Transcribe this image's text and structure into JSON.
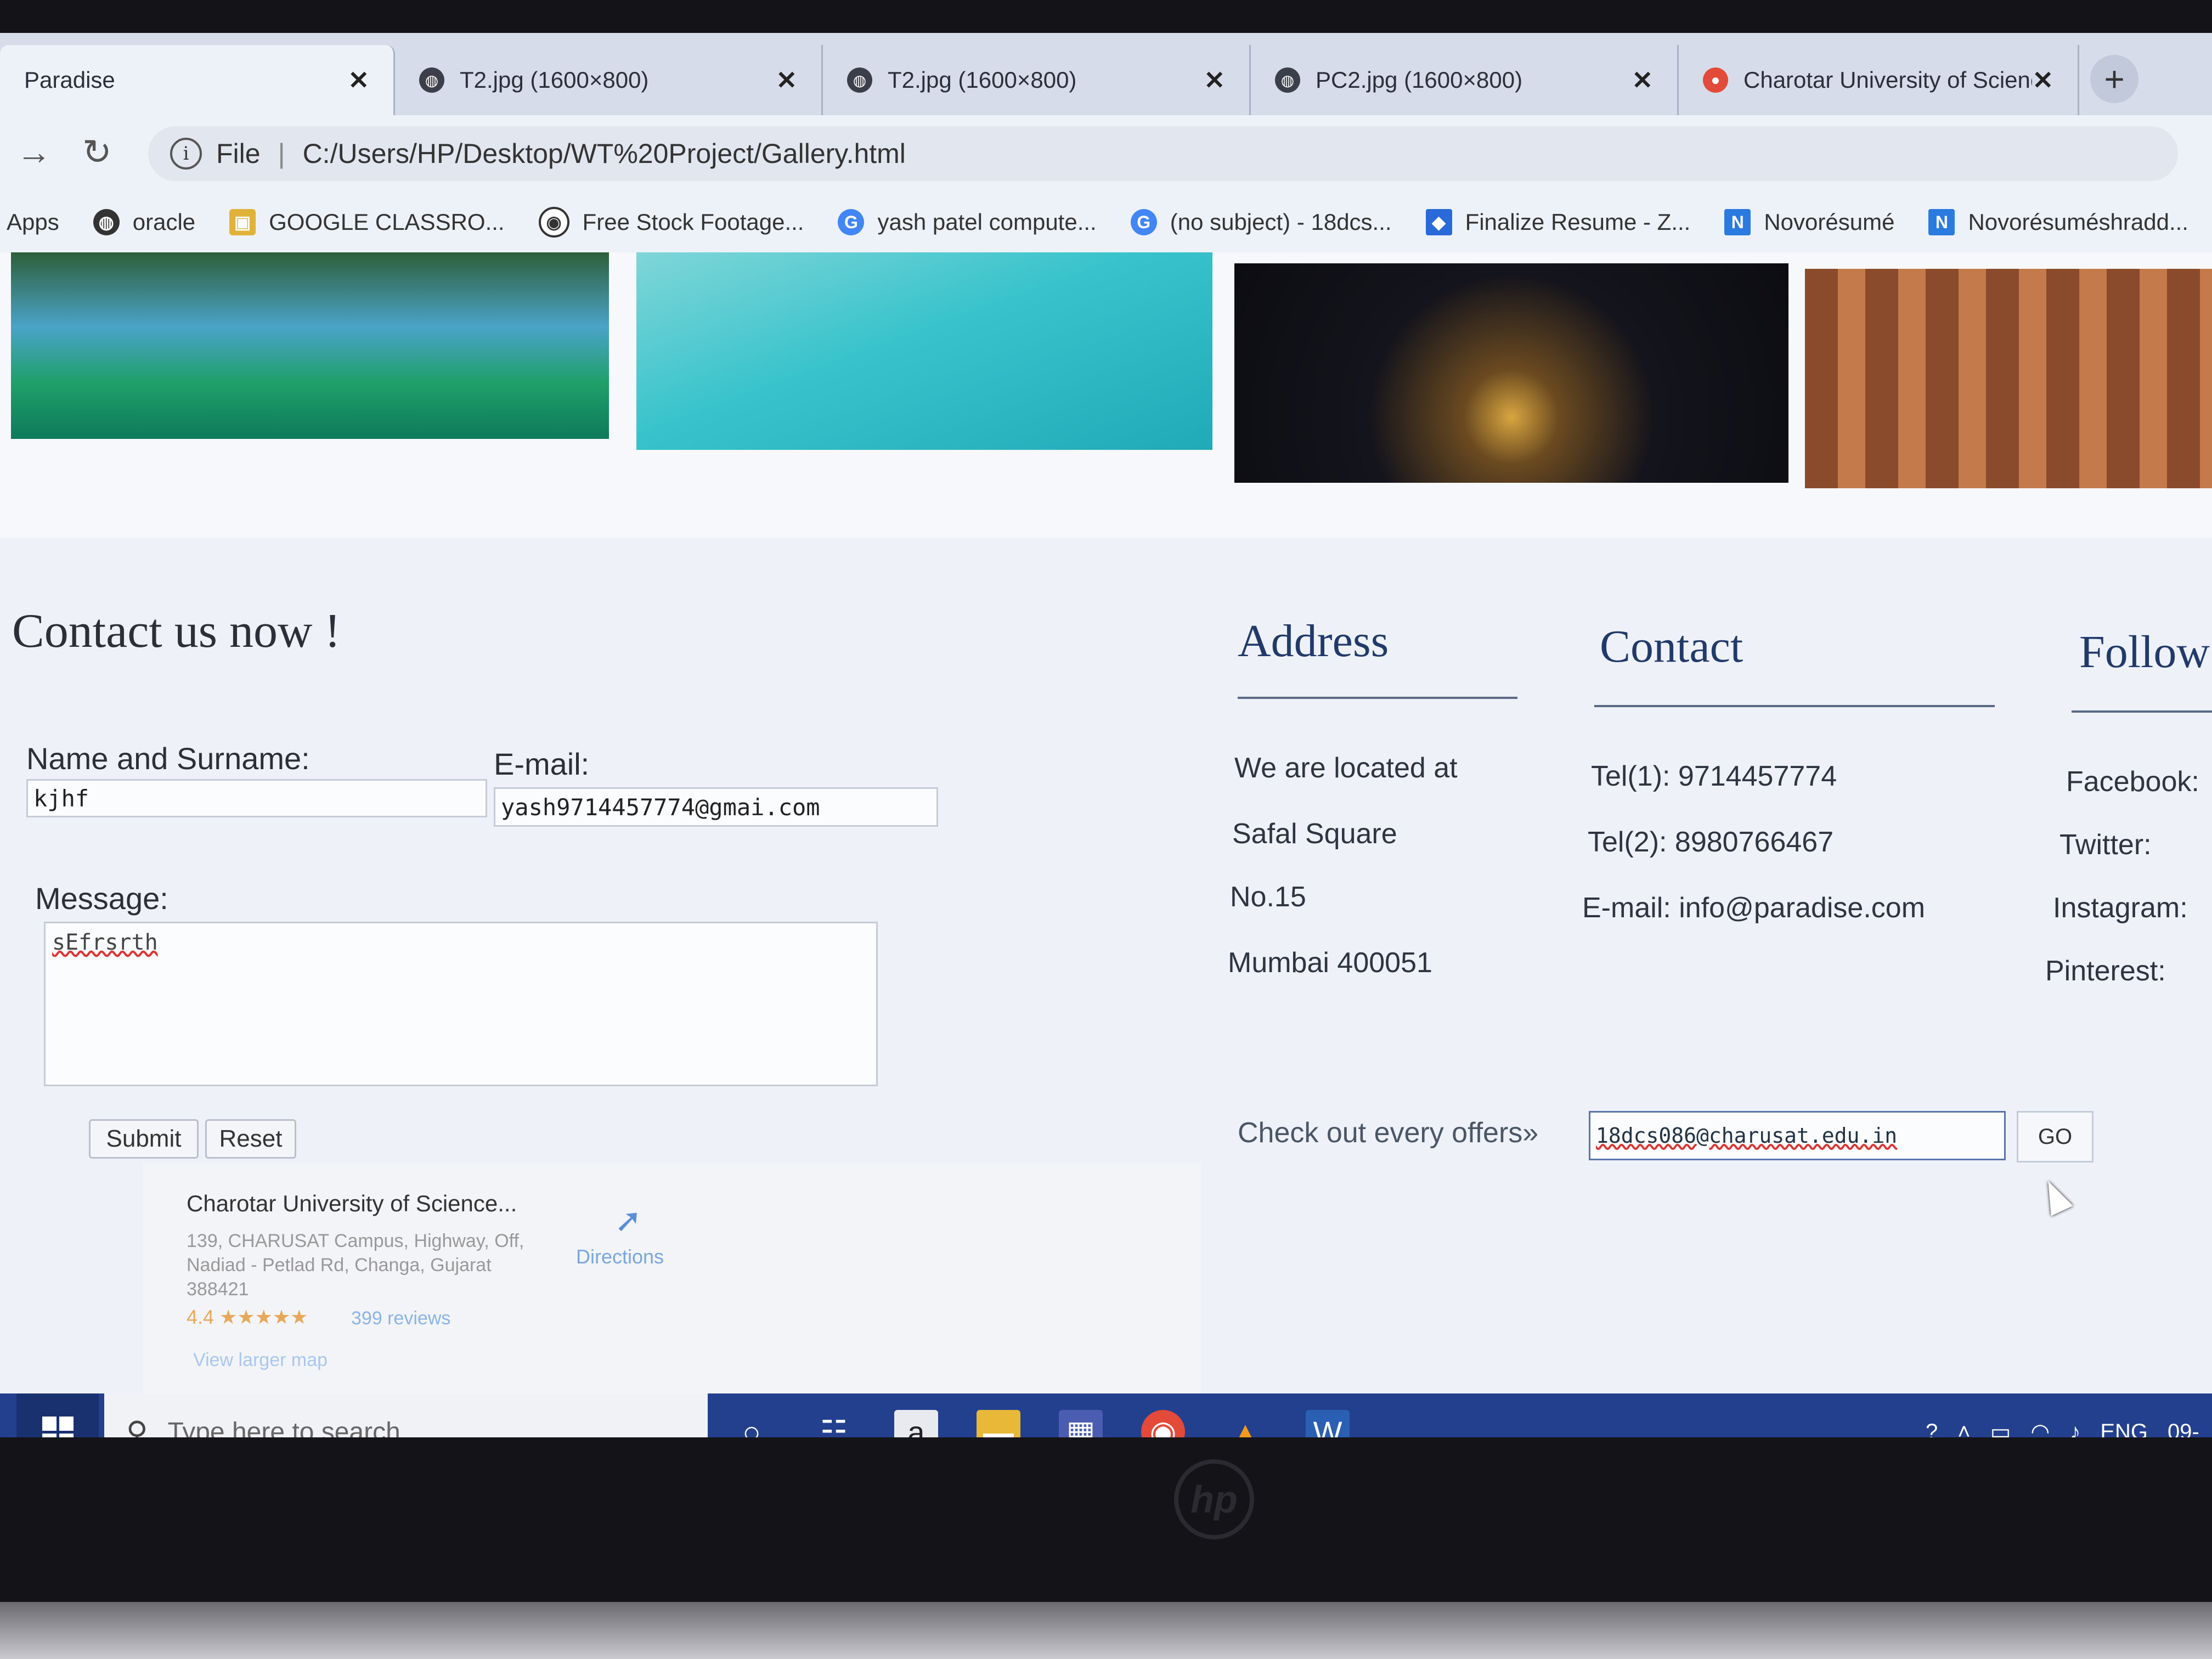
{
  "browser": {
    "tabs": [
      {
        "title": "Paradise",
        "active": true
      },
      {
        "title": "T2.jpg (1600×800)"
      },
      {
        "title": "T2.jpg (1600×800)"
      },
      {
        "title": "PC2.jpg (1600×800)"
      },
      {
        "title": "Charotar University of Science"
      }
    ],
    "address": {
      "scheme": "File",
      "url": "C:/Users/HP/Desktop/WT%20Project/Gallery.html"
    },
    "bookmarks": [
      {
        "label": "Apps"
      },
      {
        "label": "oracle"
      },
      {
        "label": "GOOGLE CLASSRO..."
      },
      {
        "label": "Free Stock Footage..."
      },
      {
        "label": "yash patel compute..."
      },
      {
        "label": "(no subject) - 18dcs..."
      },
      {
        "label": "Finalize Resume - Z..."
      },
      {
        "label": "Novorésumé"
      },
      {
        "label": "Novorésuméshradd..."
      }
    ]
  },
  "contact_form": {
    "title": "Contact us now !",
    "name_label": "Name and Surname:",
    "name_value": "kjhf",
    "email_label": "E-mail:",
    "email_value": "yash9714457774@gmai.com",
    "message_label": "Message:",
    "message_value": "sEfrsrth",
    "submit_label": "Submit",
    "reset_label": "Reset"
  },
  "map_card": {
    "title": "Charotar University of Science...",
    "address": "139, CHARUSAT Campus, Highway, Off, Nadiad - Petlad Rd, Changa, Gujarat 388421",
    "rating": "4.4 ★★★★★",
    "reviews": "399 reviews",
    "directions": "Directions",
    "larger_map": "View larger map"
  },
  "address": {
    "heading": "Address",
    "lines": [
      "We are located at",
      "Safal Square",
      "No.15",
      "Mumbai 400051"
    ]
  },
  "contact": {
    "heading": "Contact",
    "lines": [
      "Tel(1): 9714457774",
      "Tel(2): 8980766467",
      "E-mail: info@paradise.com"
    ]
  },
  "follow": {
    "heading": "Follow",
    "lines": [
      "Facebook:",
      "Twitter:",
      "Instagram:",
      "Pinterest:"
    ]
  },
  "offers": {
    "label": "Check out every offers»",
    "input_value": "18dcs086@charusat.edu.in",
    "go_label": "GO"
  },
  "taskbar": {
    "search_placeholder": "Type here to search",
    "language": "ENG",
    "clock": "09-"
  },
  "colors": {
    "taskbar": "#23408f",
    "heading": "#213a6a",
    "tab_strip": "#d6dcea"
  }
}
